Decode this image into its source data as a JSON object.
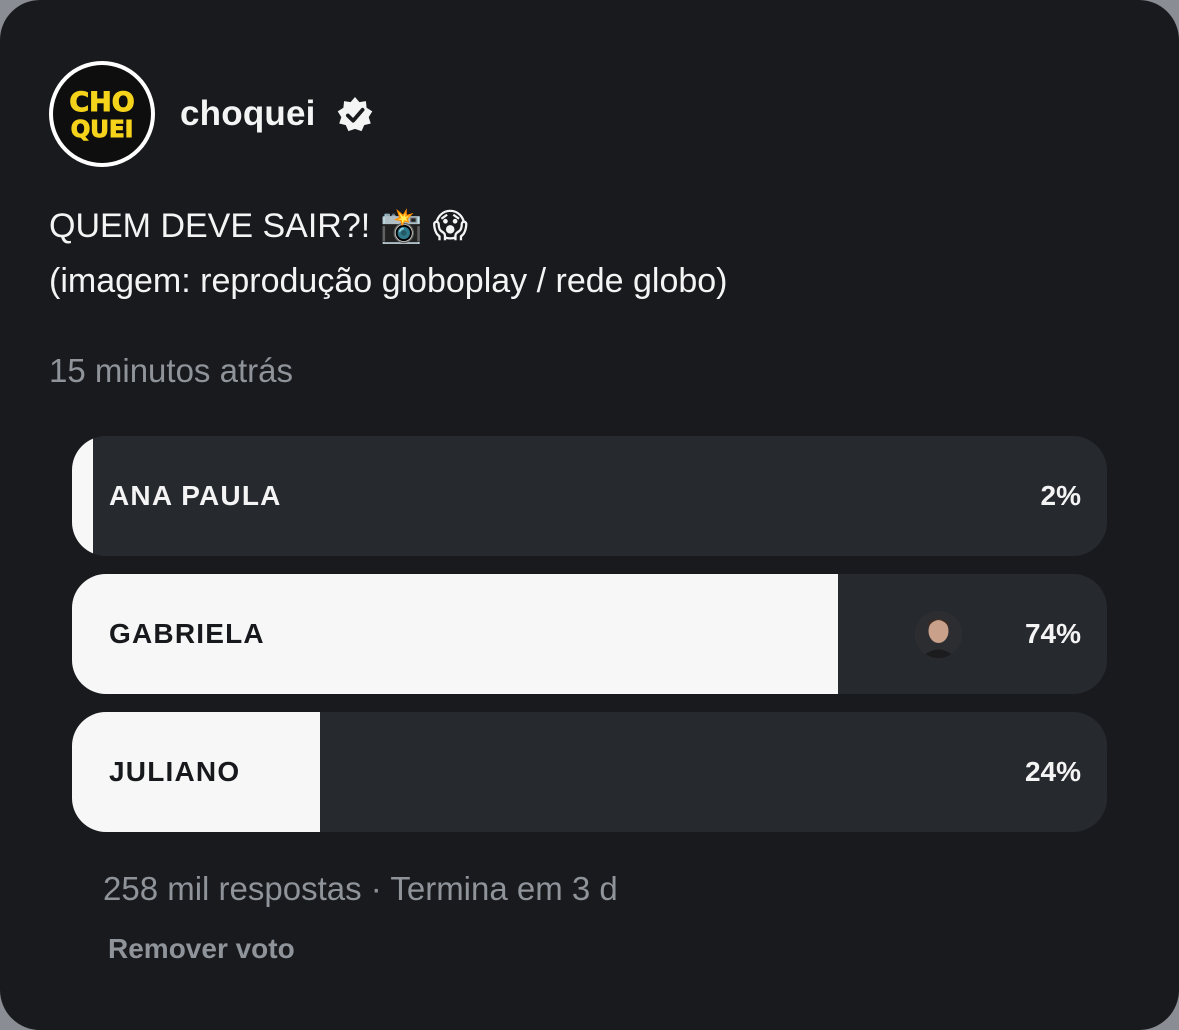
{
  "post": {
    "username": "choquei",
    "avatar_text_line1": "CHO",
    "avatar_text_line2": "QUEI",
    "caption_line1": "QUEM DEVE SAIR?!",
    "caption_emoji_1": "📸",
    "caption_emoji_2": "😱",
    "caption_line2": "(imagem: reprodução globoplay / rede globo)",
    "timestamp": "15 minutos atrás"
  },
  "poll": {
    "options": [
      {
        "label": "ANA PAULA",
        "percent_text": "2%",
        "fill_fraction": 0.02,
        "voted": false
      },
      {
        "label": "GABRIELA",
        "percent_text": "74%",
        "fill_fraction": 0.74,
        "voted": true
      },
      {
        "label": "JULIANO",
        "percent_text": "24%",
        "fill_fraction": 0.24,
        "voted": false
      }
    ],
    "footer": "258 mil respostas · Termina em 3 d",
    "remove_vote_label": "Remover voto"
  },
  "colors": {
    "background": "#181a1d",
    "option_track": "#26292e",
    "option_fill": "#f7f7f7",
    "muted_text": "#8f939a",
    "logo_yellow": "#f5d31a"
  },
  "icons": {
    "verified": "verified-badge-icon",
    "voter": "voter-avatar"
  }
}
